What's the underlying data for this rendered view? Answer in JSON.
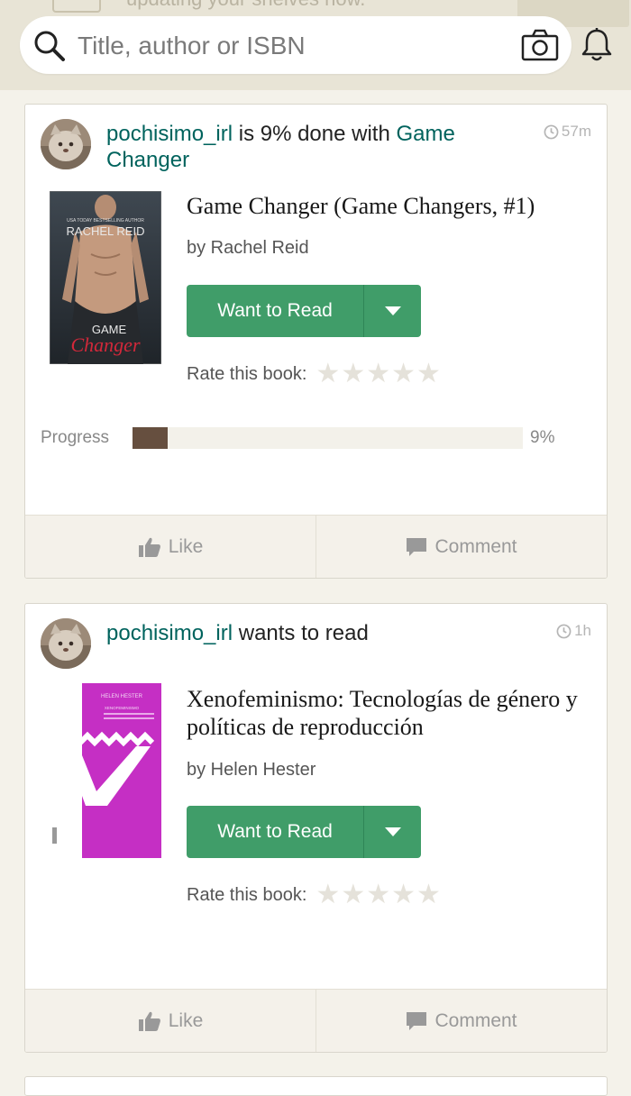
{
  "search": {
    "placeholder": "Title, author or ISBN"
  },
  "topbar": {
    "ghost_text": "updating your shelves now."
  },
  "colors": {
    "accent_green": "#409d69",
    "link_teal": "#00635d",
    "progress_brown": "#664f3f",
    "background": "#f4f2ea"
  },
  "icons": {
    "search": "magnifier-icon",
    "camera": "camera-icon",
    "notifications": "bell-icon",
    "time": "clock-icon",
    "like": "thumbs-up-icon",
    "comment": "speech-bubble-icon",
    "dropdown": "caret-down-icon",
    "star": "star-icon"
  },
  "feed": [
    {
      "user": "pochisimo_irl",
      "action": " is 9% done with ",
      "target": "Game Changer",
      "time": "57m",
      "book": {
        "title": "Game Changer (Game Changers, #1)",
        "author": "by Rachel Reid",
        "cover_top": "USA TODAY BESTSELLING AUTHOR",
        "cover_author": "RACHEL REID",
        "cover_line1": "GAME",
        "cover_line2": "Changer"
      },
      "button": "Want to Read",
      "rate_label": "Rate this book:",
      "progress_label": "Progress",
      "progress_value": "9%",
      "progress_fraction": 0.09,
      "like": "Like",
      "comment": "Comment"
    },
    {
      "user": "pochisimo_irl",
      "action": " wants to read",
      "time": "1h",
      "book": {
        "title": "Xenofeminismo: Tecnologías de género y políticas de reproducción",
        "author": "by Helen Hester",
        "cover_author": "HELEN HESTER",
        "cover_title": "XENOFEMINISMO"
      },
      "button": "Want to Read",
      "rate_label": "Rate this book:",
      "like": "Like",
      "comment": "Comment"
    }
  ]
}
